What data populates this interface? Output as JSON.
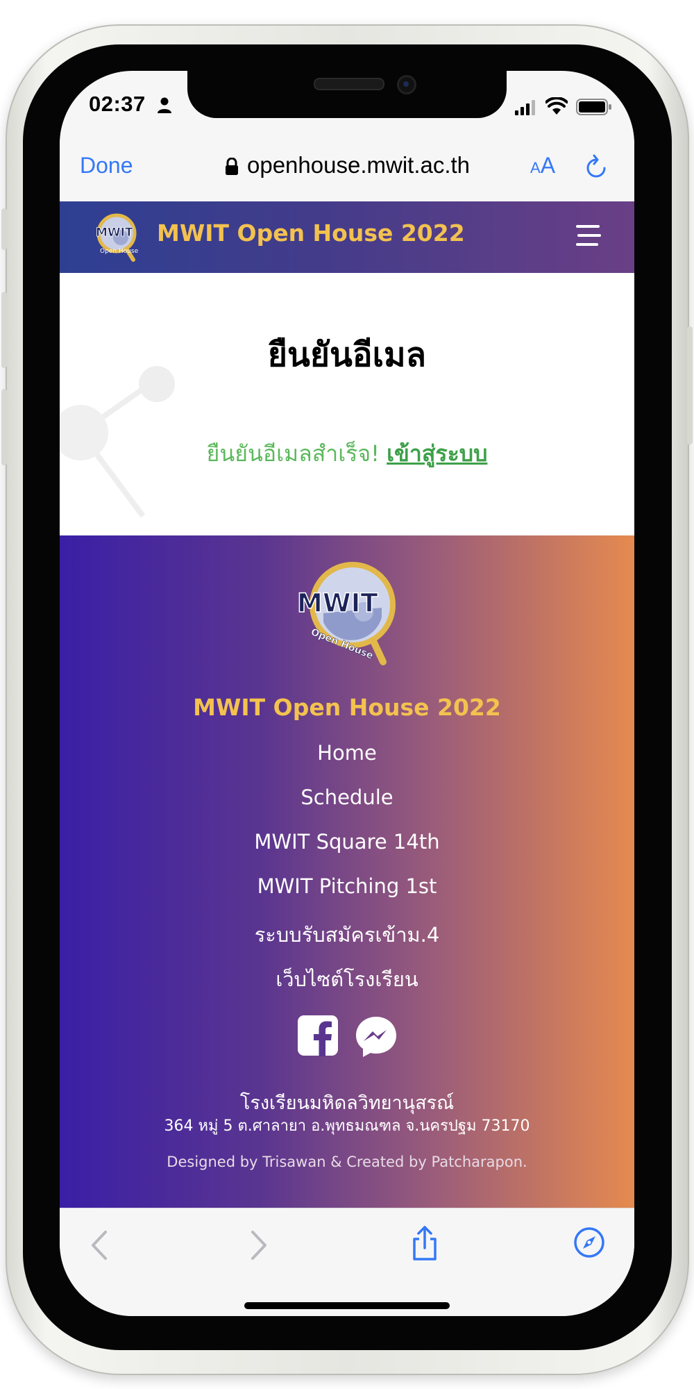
{
  "status_bar": {
    "time": "02:37",
    "icons": [
      "person-icon",
      "signal-icon",
      "wifi-icon",
      "battery-icon"
    ]
  },
  "browser": {
    "done_label": "Done",
    "url": "openhouse.mwit.ac.th",
    "text_size_label_small": "A",
    "text_size_label_large": "A",
    "icons": [
      "lock-icon",
      "reload-icon",
      "back-arrow-icon",
      "forward-arrow-icon",
      "share-icon",
      "compass-icon"
    ]
  },
  "header": {
    "title": "MWIT Open House 2022",
    "menu_icon": "hamburger-menu-icon"
  },
  "main": {
    "title": "ยืนยันอีเมล",
    "message": "ยืนยันอีเมลสำเร็จ!",
    "login_link": "เข้าสู่ระบบ"
  },
  "footer": {
    "title": "MWIT Open House 2022",
    "links": [
      "Home",
      "Schedule",
      "MWIT Square 14th",
      "MWIT Pitching 1st",
      "ระบบรับสมัครเข้าม.4",
      "เว็บไซต์โรงเรียน"
    ],
    "social": [
      "facebook-icon",
      "messenger-icon"
    ],
    "school_name": "โรงเรียนมหิดลวิทยานุสรณ์",
    "address": "364 หมู่ 5 ต.ศาลายา อ.พุทธมณฑล จ.นครปฐม 73170",
    "credits": "Designed by Trisawan & Created by Patcharapon."
  },
  "colors": {
    "accent_blue": "#3478f6",
    "title_gold": "#f3c24f",
    "success_green": "#5cb85c",
    "footer_gradient_start": "#3a1fa6",
    "footer_gradient_end": "#e58a4f"
  }
}
